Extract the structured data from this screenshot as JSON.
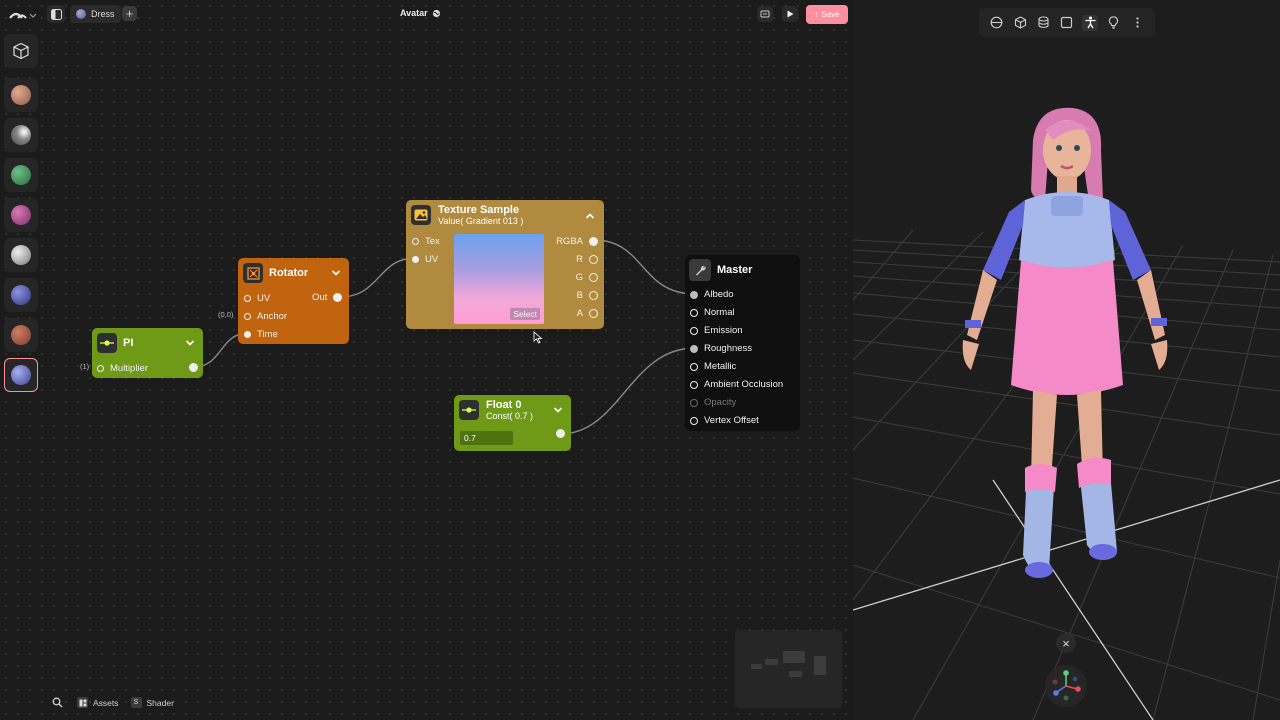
{
  "header": {
    "tab_label": "Dress",
    "add_tab_label": "+",
    "title": "Avatar",
    "save_label": "Save"
  },
  "colors": {
    "accent": "#ff8f9f",
    "node_green": "#6f9a18",
    "node_orange": "#c1640f",
    "node_gold": "#b08a3f",
    "node_master": "#0f0f0f"
  },
  "sidebar": {
    "items": [
      {
        "icon": "cube-icon"
      },
      {
        "icon": "material-sphere-icon",
        "color": "#b07a65"
      },
      {
        "icon": "material-sphere-icon",
        "color": "#7d7d7d"
      },
      {
        "icon": "material-sphere-icon",
        "color": "#3f8a5a"
      },
      {
        "icon": "material-sphere-icon",
        "color": "#a8478a"
      },
      {
        "icon": "material-sphere-icon",
        "color": "#9a9a9a"
      },
      {
        "icon": "material-sphere-icon",
        "color": "#4a56a8"
      },
      {
        "icon": "material-sphere-icon",
        "color": "#9a5040"
      },
      {
        "icon": "material-sphere-icon",
        "color": "#6a73b8",
        "selected": true
      }
    ]
  },
  "nodes": {
    "pi": {
      "title": "PI",
      "inputs": [
        "Multiplier"
      ],
      "input_default": "(1)"
    },
    "rotator": {
      "title": "Rotator",
      "inputs": [
        "UV",
        "Anchor",
        "Time"
      ],
      "output": "Out",
      "anchor_default": "(0,0)"
    },
    "texture": {
      "title": "Texture Sample",
      "subtitle": "Value( Gradient 013 )",
      "inputs": [
        "Tex",
        "UV"
      ],
      "outputs": [
        "RGBA",
        "R",
        "G",
        "B",
        "A"
      ],
      "select_label": "Select"
    },
    "master": {
      "title": "Master",
      "inputs": [
        "Albedo",
        "Normal",
        "Emission",
        "Roughness",
        "Metallic",
        "Ambient Occlusion",
        "Opacity",
        "Vertex Offset"
      ]
    },
    "float": {
      "title": "Float 0",
      "subtitle": "Const( 0.7 )",
      "value": "0.7"
    }
  },
  "bottom_bar": {
    "assets_label": "Assets",
    "shader_label": "Shader",
    "shader_badge": "S"
  },
  "viewport": {
    "toolbar_icons": [
      "sphere-view-icon",
      "cube-view-icon",
      "cylinder-view-icon",
      "plane-view-icon",
      "avatar-view-icon",
      "light-icon",
      "more-icon"
    ],
    "active_icon": "avatar-view-icon",
    "close_label": "×"
  }
}
